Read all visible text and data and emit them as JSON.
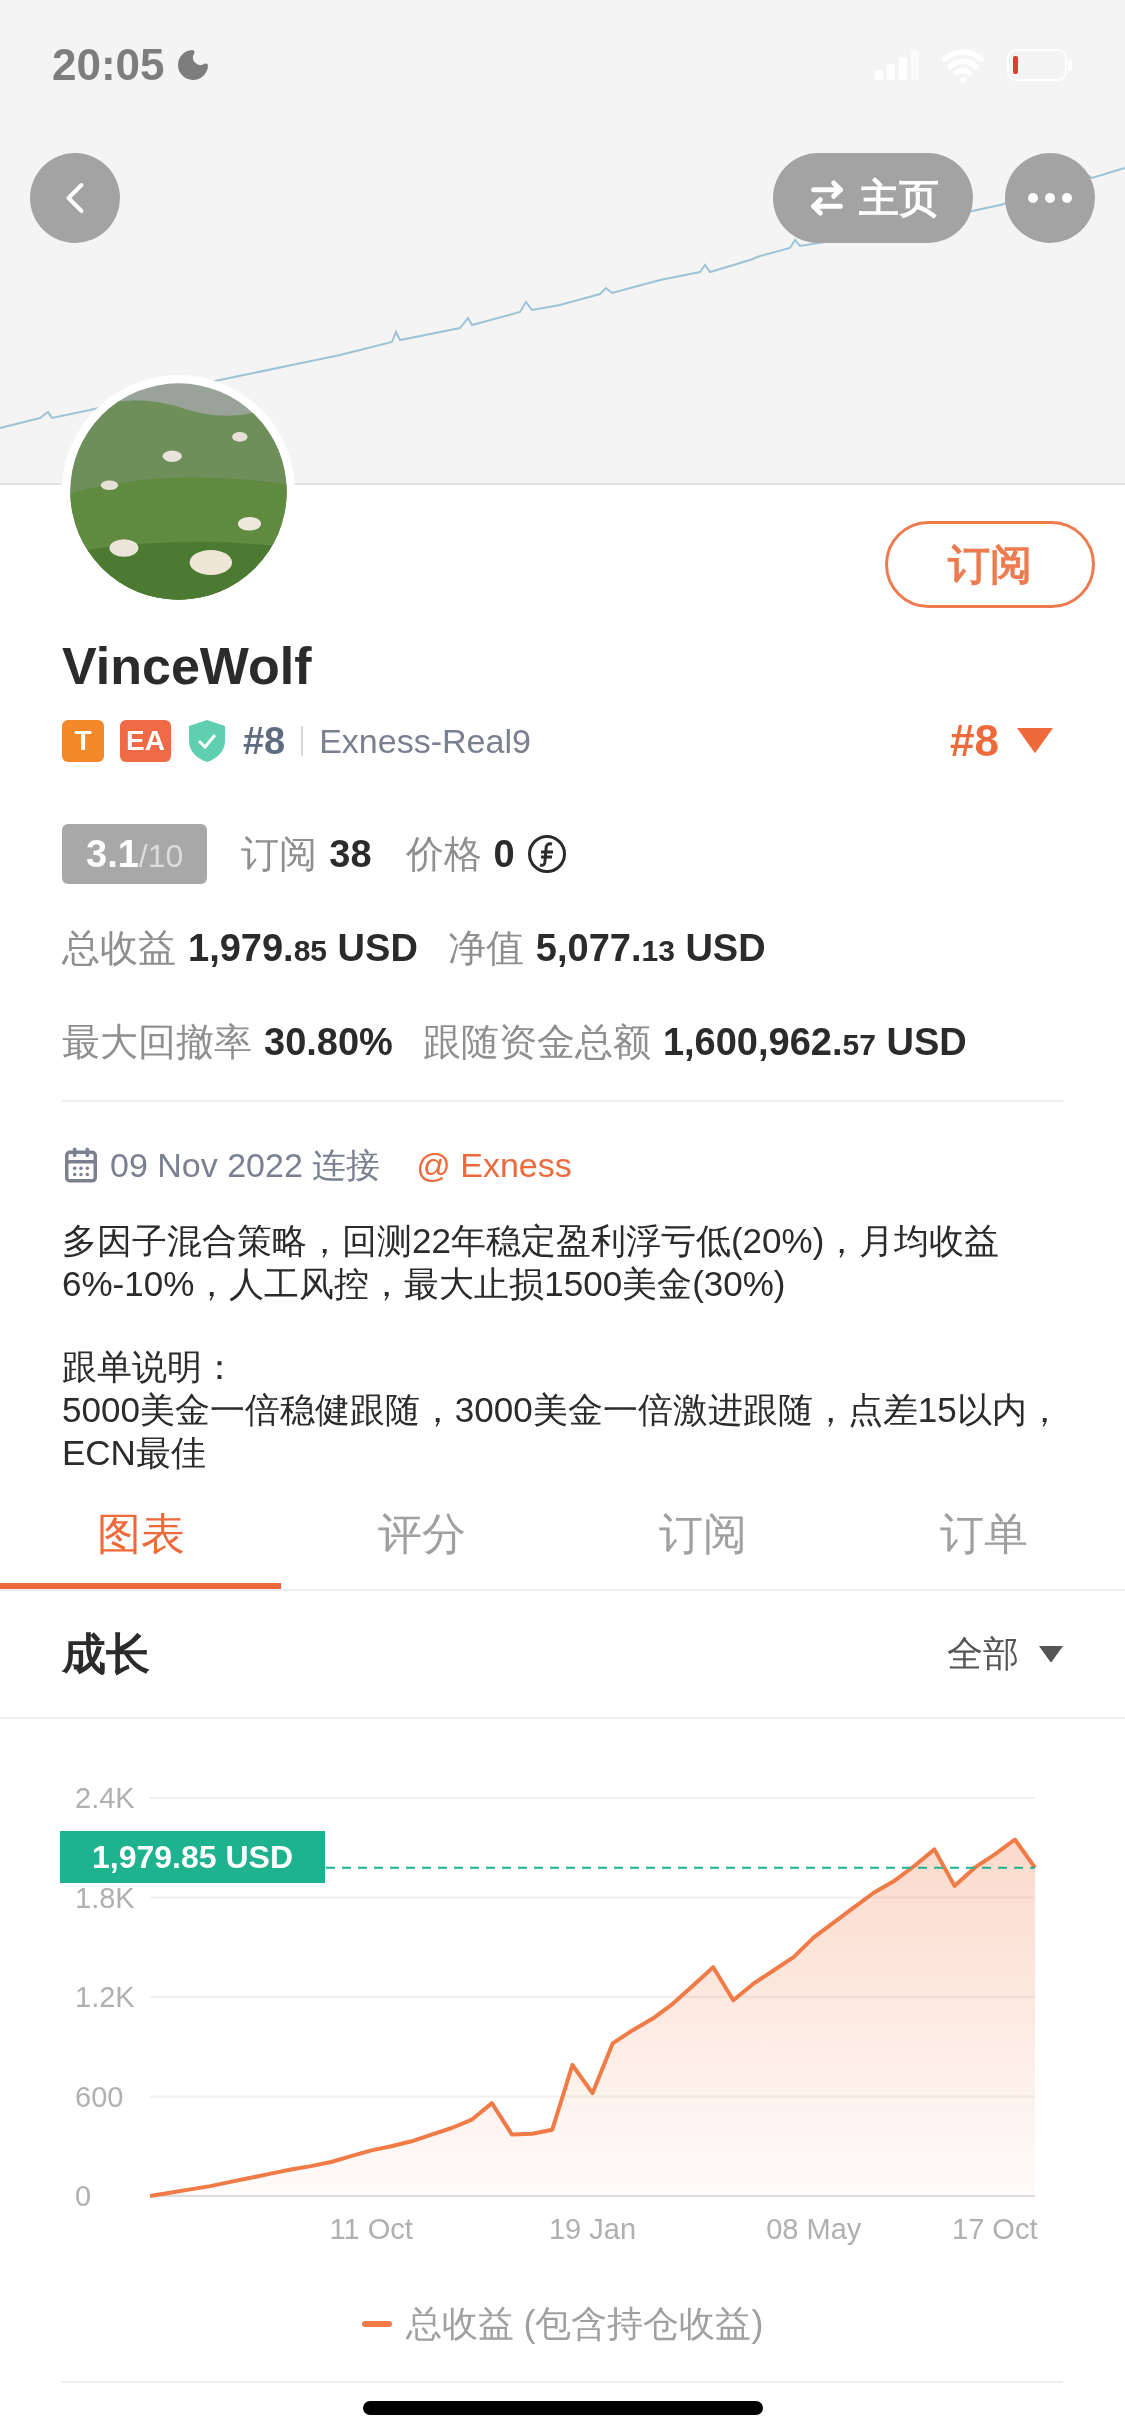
{
  "status_bar": {
    "time": "20:05"
  },
  "nav": {
    "home_label": "主页"
  },
  "profile": {
    "name": "VinceWolf",
    "subscribe_label": "订阅",
    "badges": [
      {
        "kind": "letter",
        "text": "T",
        "color": "#f5892a"
      },
      {
        "kind": "letter",
        "text": "EA",
        "color": "#ef6a45"
      },
      {
        "kind": "shield",
        "color": "#5fcfb0"
      }
    ],
    "rank": "#8",
    "server": "Exness-Real9",
    "rank_selector": "#8"
  },
  "rating": {
    "score": "3.1",
    "scale": "/10"
  },
  "stats": [
    {
      "kind": "count",
      "label": "订阅",
      "value": "38"
    },
    {
      "kind": "price",
      "label": "价格",
      "value": "0"
    }
  ],
  "metrics": [
    {
      "items": [
        {
          "label": "总收益",
          "value": "1,979.",
          "fraction": "85",
          "unit": "USD"
        },
        {
          "label": "净值",
          "value": "5,077.",
          "fraction": "13",
          "unit": "USD"
        }
      ]
    },
    {
      "items": [
        {
          "label": "最大回撤率",
          "value": "30.80%"
        },
        {
          "label": "跟随资金总额",
          "value": "1,600,962.",
          "fraction": "57",
          "unit": "USD"
        }
      ]
    }
  ],
  "connection": {
    "date_text": "09 Nov 2022 连接",
    "broker": "@ Exness"
  },
  "description": {
    "paragraphs": [
      {
        "lines": [
          "多因子混合策略，回测22年稳定盈利浮亏低(20%)，月均收益6%-10%，人工风控，最大止损1500美金(30%)"
        ]
      },
      {
        "lines": [
          "跟单说明：",
          "5000美金一倍稳健跟随，3000美金一倍激进跟随，点差15以内，ECN最佳"
        ]
      }
    ]
  },
  "tabs": [
    {
      "label": "图表",
      "selected": true
    },
    {
      "label": "评分",
      "selected": false
    },
    {
      "label": "订阅",
      "selected": false
    },
    {
      "label": "订单",
      "selected": false
    }
  ],
  "growth": {
    "title": "成长",
    "filter": "全部",
    "chart_data": {
      "type": "area",
      "grid": true,
      "categories": [
        null,
        null,
        null,
        null,
        null,
        null,
        null,
        null,
        null,
        null,
        null,
        "11 Oct",
        null,
        null,
        null,
        null,
        null,
        null,
        null,
        null,
        null,
        null,
        "19 Jan",
        null,
        null,
        null,
        null,
        null,
        null,
        null,
        null,
        null,
        null,
        "08 May",
        null,
        null,
        null,
        null,
        null,
        null,
        null,
        null,
        "17 Oct",
        null,
        null
      ],
      "series": [
        {
          "name": "总收益 (包含持仓收益)",
          "color": "#f07b47",
          "values": [
            0,
            20,
            40,
            60,
            85,
            110,
            135,
            160,
            180,
            205,
            240,
            275,
            300,
            330,
            370,
            410,
            460,
            560,
            370,
            375,
            400,
            790,
            620,
            920,
            1000,
            1070,
            1160,
            1270,
            1380,
            1180,
            1280,
            1360,
            1440,
            1560,
            1650,
            1740,
            1830,
            1900,
            1990,
            2090,
            1870,
            1980,
            2060,
            2150,
            1980
          ]
        }
      ],
      "ylim": [
        0,
        2400
      ],
      "yticks": [
        {
          "value": 0,
          "label": "0"
        },
        {
          "value": 600,
          "label": "600"
        },
        {
          "value": 1200,
          "label": "1.2K"
        },
        {
          "value": 1800,
          "label": "1.8K"
        },
        {
          "value": 2400,
          "label": "2.4K"
        }
      ],
      "ref_lines": [
        {
          "axis": "y",
          "value": 1979.85,
          "label": "1,979.85 USD",
          "color": "#1fb28f"
        }
      ]
    }
  }
}
